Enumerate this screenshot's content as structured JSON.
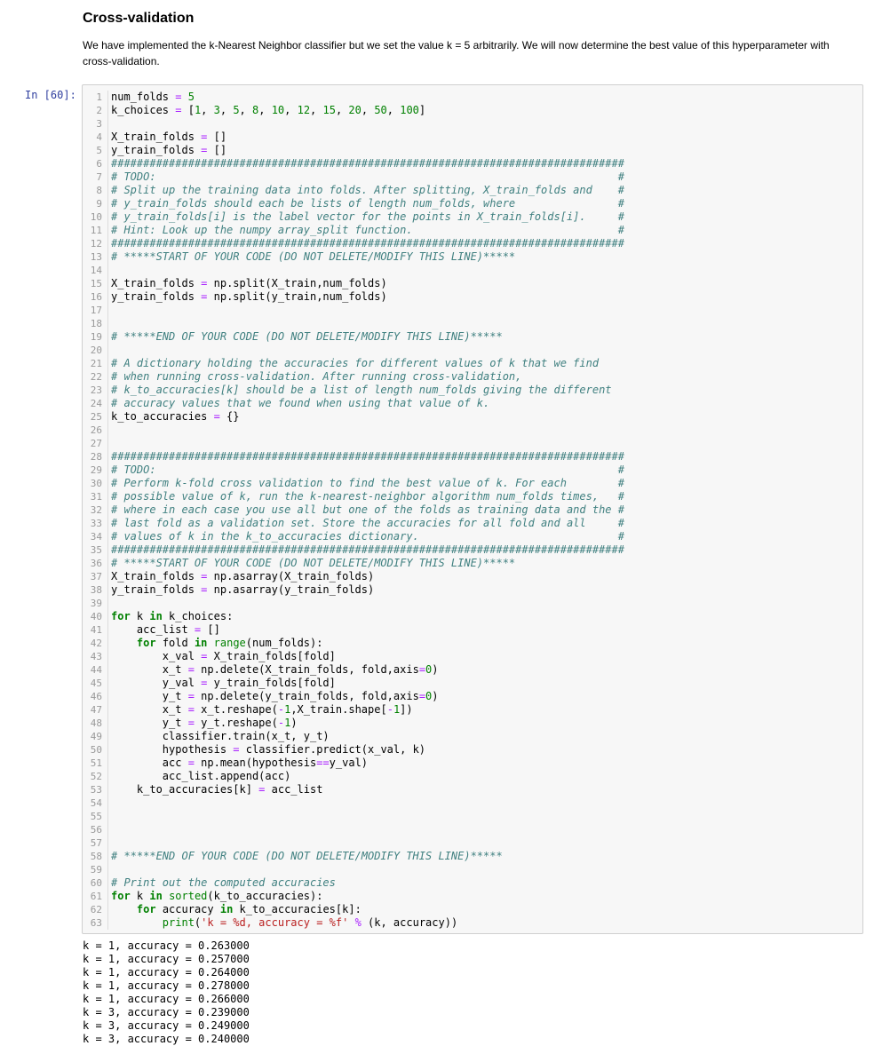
{
  "markdown": {
    "title": "Cross-validation",
    "paragraph": "We have implemented the k-Nearest Neighbor classifier but we set the value k = 5 arbitrarily. We will now determine the best value of this hyperparameter with cross-validation."
  },
  "cell": {
    "prompt": "In [60]:",
    "lines": [
      "num_folds = 5",
      "k_choices = [1, 3, 5, 8, 10, 12, 15, 20, 50, 100]",
      "",
      "X_train_folds = []",
      "y_train_folds = []",
      "################################################################################",
      "# TODO:                                                                        #",
      "# Split up the training data into folds. After splitting, X_train_folds and    #",
      "# y_train_folds should each be lists of length num_folds, where                #",
      "# y_train_folds[i] is the label vector for the points in X_train_folds[i].     #",
      "# Hint: Look up the numpy array_split function.                                #",
      "################################################################################",
      "# *****START OF YOUR CODE (DO NOT DELETE/MODIFY THIS LINE)*****",
      "",
      "X_train_folds = np.split(X_train,num_folds)",
      "y_train_folds = np.split(y_train,num_folds)",
      "",
      "",
      "# *****END OF YOUR CODE (DO NOT DELETE/MODIFY THIS LINE)*****",
      "",
      "# A dictionary holding the accuracies for different values of k that we find",
      "# when running cross-validation. After running cross-validation,",
      "# k_to_accuracies[k] should be a list of length num_folds giving the different",
      "# accuracy values that we found when using that value of k.",
      "k_to_accuracies = {}",
      "",
      "",
      "################################################################################",
      "# TODO:                                                                        #",
      "# Perform k-fold cross validation to find the best value of k. For each        #",
      "# possible value of k, run the k-nearest-neighbor algorithm num_folds times,   #",
      "# where in each case you use all but one of the folds as training data and the #",
      "# last fold as a validation set. Store the accuracies for all fold and all     #",
      "# values of k in the k_to_accuracies dictionary.                               #",
      "################################################################################",
      "# *****START OF YOUR CODE (DO NOT DELETE/MODIFY THIS LINE)*****",
      "X_train_folds = np.asarray(X_train_folds)",
      "y_train_folds = np.asarray(y_train_folds)",
      "",
      "for k in k_choices:",
      "    acc_list = []",
      "    for fold in range(num_folds):",
      "        x_val = X_train_folds[fold]",
      "        x_t = np.delete(X_train_folds, fold,axis=0)",
      "        y_val = y_train_folds[fold]",
      "        y_t = np.delete(y_train_folds, fold,axis=0)",
      "        x_t = x_t.reshape(-1,X_train.shape[-1])",
      "        y_t = y_t.reshape(-1)",
      "        classifier.train(x_t, y_t)",
      "        hypothesis = classifier.predict(x_val, k)",
      "        acc = np.mean(hypothesis==y_val)",
      "        acc_list.append(acc)",
      "    k_to_accuracies[k] = acc_list",
      "",
      "",
      "",
      "",
      "# *****END OF YOUR CODE (DO NOT DELETE/MODIFY THIS LINE)*****",
      "",
      "# Print out the computed accuracies",
      "for k in sorted(k_to_accuracies):",
      "    for accuracy in k_to_accuracies[k]:",
      "        print('k = %d, accuracy = %f' % (k, accuracy))"
    ]
  },
  "output": {
    "lines": [
      "k = 1, accuracy = 0.263000",
      "k = 1, accuracy = 0.257000",
      "k = 1, accuracy = 0.264000",
      "k = 1, accuracy = 0.278000",
      "k = 1, accuracy = 0.266000",
      "k = 3, accuracy = 0.239000",
      "k = 3, accuracy = 0.249000",
      "k = 3, accuracy = 0.240000"
    ]
  }
}
